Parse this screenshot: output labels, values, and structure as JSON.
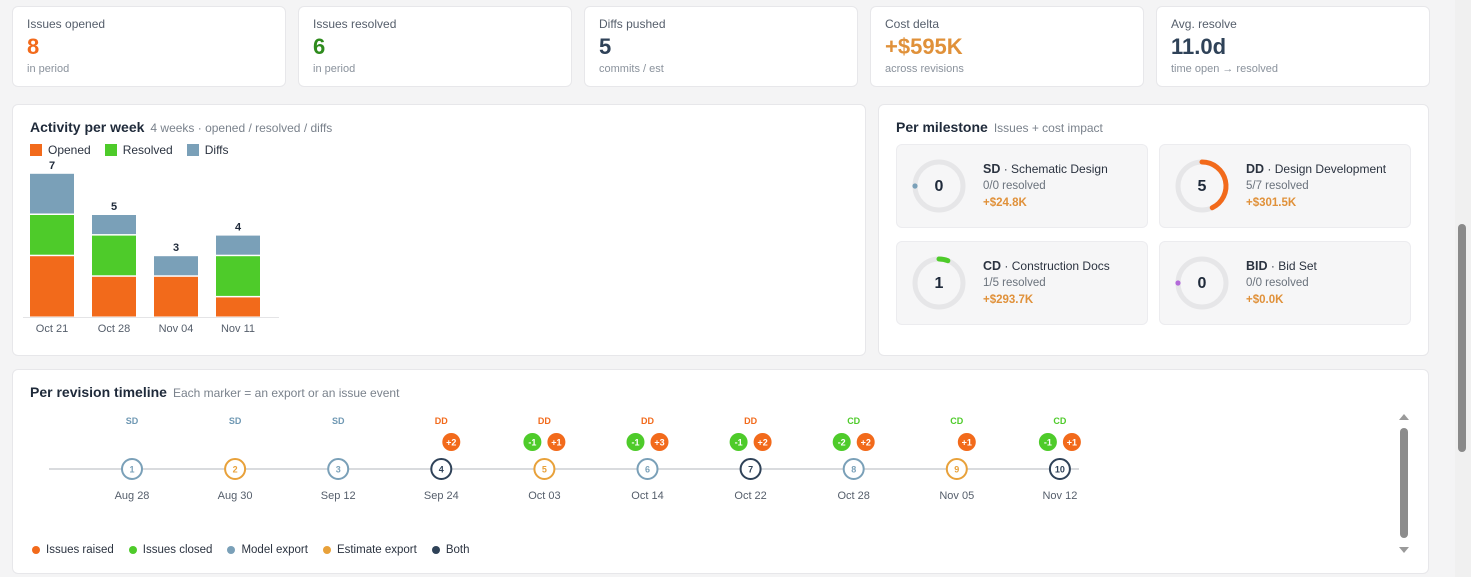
{
  "kpis": [
    {
      "label": "Issues opened",
      "value": "8",
      "sub": "in period",
      "color": "#f26a1b"
    },
    {
      "label": "Issues resolved",
      "value": "6",
      "sub": "in period",
      "color": "#2e8b1d"
    },
    {
      "label": "Diffs pushed",
      "value": "5",
      "sub": "commits / est",
      "color": "#2f4258"
    },
    {
      "label": "Cost delta",
      "value": "+$595K",
      "sub": "across revisions",
      "color": "#e0913a"
    },
    {
      "label": "Avg. resolve",
      "value": "11.0d",
      "sub": "time open → resolved",
      "color": "#2f4258"
    }
  ],
  "activity": {
    "title": "Activity per week",
    "subtitle": "4 weeks · opened / resolved / diffs",
    "legend": [
      {
        "label": "Opened",
        "color": "#f26a1b"
      },
      {
        "label": "Resolved",
        "color": "#4ecb2a"
      },
      {
        "label": "Diffs",
        "color": "#7aa0b8"
      }
    ]
  },
  "chart_data": {
    "type": "bar",
    "stacked": true,
    "categories": [
      "Oct 21",
      "Oct 28",
      "Nov 04",
      "Nov 11"
    ],
    "series": [
      {
        "name": "Opened",
        "values": [
          3,
          2,
          2,
          1
        ],
        "color": "#f26a1b"
      },
      {
        "name": "Resolved",
        "values": [
          2,
          2,
          0,
          2
        ],
        "color": "#4ecb2a"
      },
      {
        "name": "Diffs",
        "values": [
          2,
          1,
          1,
          1
        ],
        "color": "#7aa0b8"
      }
    ],
    "totals": [
      "7",
      "5",
      "3",
      "4"
    ],
    "ylim": [
      0,
      7
    ]
  },
  "milestones": {
    "title": "Per milestone",
    "subtitle": "Issues + cost impact",
    "items": [
      {
        "code": "SD",
        "name": " · Schematic Design",
        "count": "0",
        "resolved": "0/0 resolved",
        "cost": "+$24.8K",
        "color": "#7aa0b8",
        "fraction": 0
      },
      {
        "code": "DD",
        "name": " · Design Development",
        "count": "5",
        "resolved": "5/7 resolved",
        "cost": "+$301.5K",
        "color": "#f26a1b",
        "fraction": 0.43
      },
      {
        "code": "CD",
        "name": " · Construction Docs",
        "count": "1",
        "resolved": "1/5 resolved",
        "cost": "+$293.7K",
        "color": "#4ecb2a",
        "fraction": 0.06
      },
      {
        "code": "BID",
        "name": " · Bid Set",
        "count": "0",
        "resolved": "0/0 resolved",
        "cost": "+$0.0K",
        "color": "#b36ad9",
        "fraction": 0
      }
    ]
  },
  "timeline": {
    "title": "Per revision timeline",
    "subtitle": "Each marker = an export or an issue event",
    "revisions": [
      {
        "num": "1",
        "date": "Aug 28",
        "phase": "SD",
        "kind": "model",
        "badges": []
      },
      {
        "num": "2",
        "date": "Aug 30",
        "phase": "SD",
        "kind": "estimate",
        "badges": []
      },
      {
        "num": "3",
        "date": "Sep 12",
        "phase": "SD",
        "kind": "model",
        "badges": []
      },
      {
        "num": "4",
        "date": "Sep 24",
        "phase": "DD",
        "kind": "both",
        "badges": [
          {
            "t": "+2",
            "k": "raised"
          }
        ]
      },
      {
        "num": "5",
        "date": "Oct 03",
        "phase": "DD",
        "kind": "estimate",
        "badges": [
          {
            "t": "-1",
            "k": "closed"
          },
          {
            "t": "+1",
            "k": "raised"
          }
        ]
      },
      {
        "num": "6",
        "date": "Oct 14",
        "phase": "DD",
        "kind": "model",
        "badges": [
          {
            "t": "-1",
            "k": "closed"
          },
          {
            "t": "+3",
            "k": "raised"
          }
        ]
      },
      {
        "num": "7",
        "date": "Oct 22",
        "phase": "DD",
        "kind": "both",
        "badges": [
          {
            "t": "-1",
            "k": "closed"
          },
          {
            "t": "+2",
            "k": "raised"
          }
        ]
      },
      {
        "num": "8",
        "date": "Oct 28",
        "phase": "CD",
        "kind": "model",
        "badges": [
          {
            "t": "-2",
            "k": "closed"
          },
          {
            "t": "+2",
            "k": "raised"
          }
        ]
      },
      {
        "num": "9",
        "date": "Nov 05",
        "phase": "CD",
        "kind": "estimate",
        "badges": [
          {
            "t": "+1",
            "k": "raised"
          }
        ]
      },
      {
        "num": "10",
        "date": "Nov 12",
        "phase": "CD",
        "kind": "both",
        "badges": [
          {
            "t": "-1",
            "k": "closed"
          },
          {
            "t": "+1",
            "k": "raised"
          }
        ]
      }
    ],
    "phase_colors": {
      "SD": "#6f98b3",
      "DD": "#f26a1b",
      "CD": "#4ecb2a"
    },
    "kind_colors": {
      "model": "#7aa0b8",
      "estimate": "#e8a13a",
      "both": "#2f4258"
    },
    "legend": [
      {
        "label": "Issues raised",
        "color": "#f26a1b"
      },
      {
        "label": "Issues closed",
        "color": "#4ecb2a"
      },
      {
        "label": "Model export",
        "color": "#7aa0b8"
      },
      {
        "label": "Estimate export",
        "color": "#e8a13a"
      },
      {
        "label": "Both",
        "color": "#2f4258"
      }
    ]
  }
}
